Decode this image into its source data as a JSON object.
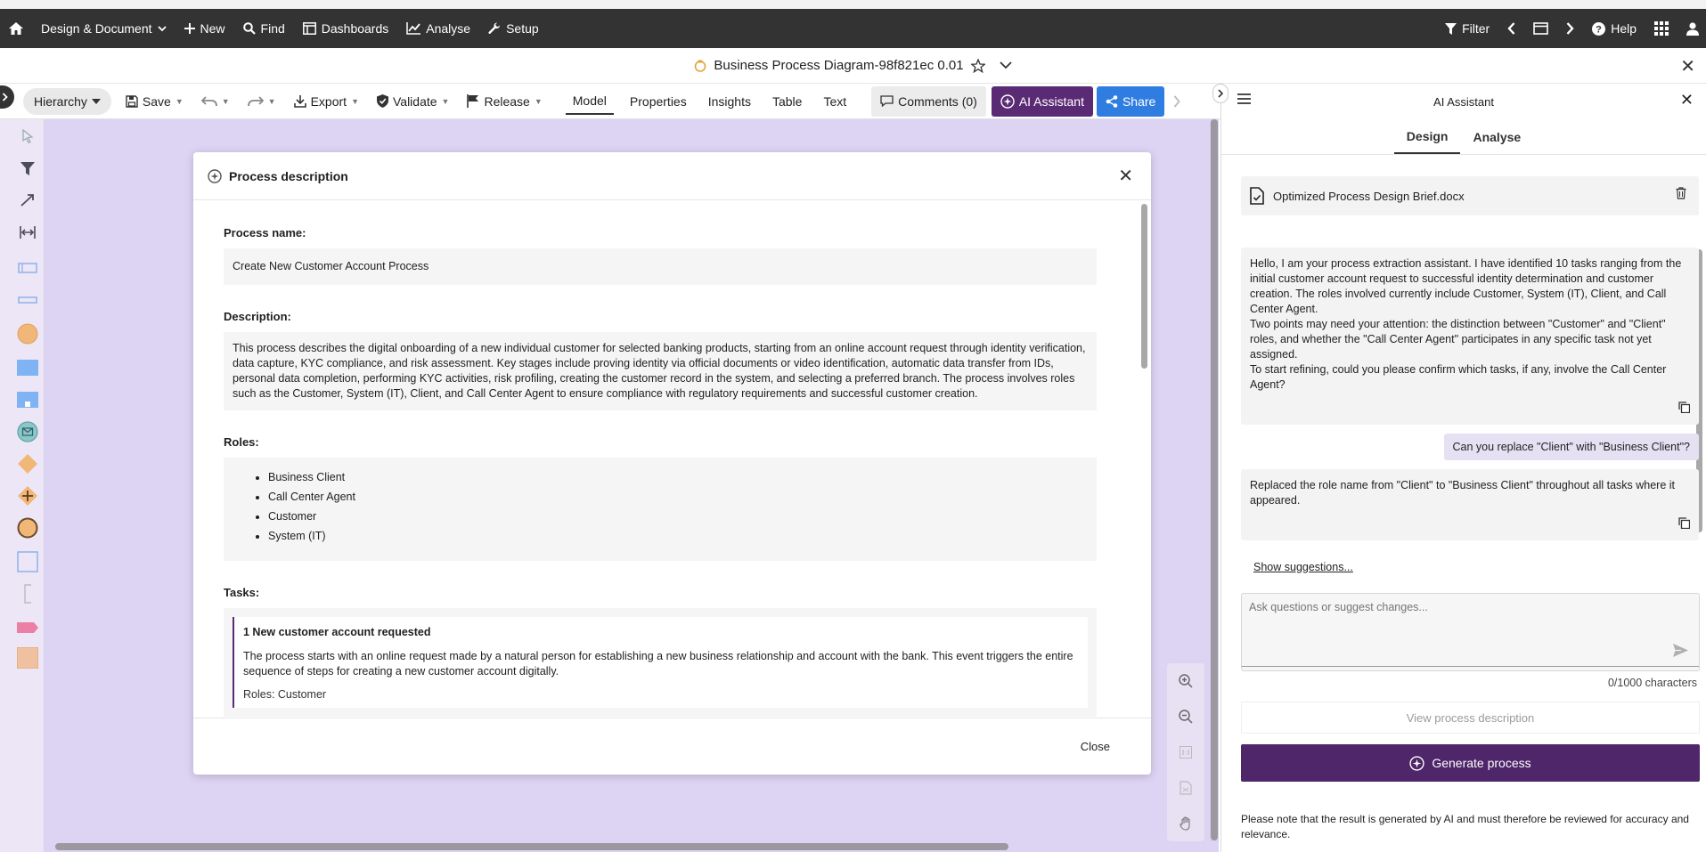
{
  "topnav": {
    "items": [
      {
        "label": "Design & Document",
        "icon": "chevron-down-icon"
      },
      {
        "label": "New",
        "icon": "plus-icon"
      },
      {
        "label": "Find",
        "icon": "search-icon"
      },
      {
        "label": "Dashboards",
        "icon": "dashboard-icon"
      },
      {
        "label": "Analyse",
        "icon": "chart-line-icon"
      },
      {
        "label": "Setup",
        "icon": "wrench-icon"
      }
    ],
    "right": {
      "filter": "Filter",
      "help": "Help"
    }
  },
  "titlebar": {
    "title": "Business Process Diagram-98f821ec 0.01"
  },
  "toolbar": {
    "hierarchy": "Hierarchy",
    "save": "Save",
    "export": "Export",
    "validate": "Validate",
    "release": "Release",
    "tabs": [
      "Model",
      "Properties",
      "Insights",
      "Table",
      "Text"
    ],
    "comments": "Comments (0)",
    "ai_assistant": "AI Assistant",
    "share": "Share"
  },
  "modal": {
    "title": "Process description",
    "process_name_label": "Process name:",
    "process_name": "Create New Customer Account Process",
    "description_label": "Description:",
    "description": "This process describes the digital onboarding of a new individual customer for selected banking products, starting from an online account request through identity verification, data capture, KYC compliance, and risk assessment. Key stages include proving identity via official documents or video identification, automatic data transfer from IDs, personal data completion, performing KYC activities, risk profiling, creating the customer record in the system, and selecting a preferred branch. The process involves roles such as the Customer, System (IT), Client, and Call Center Agent to ensure compliance with regulatory requirements and successful customer creation.",
    "roles_label": "Roles:",
    "roles": [
      "Business Client",
      "Call Center Agent",
      "Customer",
      "System (IT)"
    ],
    "tasks_label": "Tasks:",
    "tasks": [
      {
        "title": "1 New customer account requested",
        "description": "The process starts with an online request made by a natural person for establishing a new business relationship and account with the bank. This event triggers the entire sequence of steps for creating a new customer account digitally.",
        "roles": "Roles: Customer"
      }
    ],
    "close": "Close"
  },
  "ai_panel": {
    "title": "AI Assistant",
    "tabs": [
      "Design",
      "Analyse"
    ],
    "document": "Optimized Process Design Brief.docx",
    "messages": [
      {
        "from": "ai",
        "lines": [
          "Hello, I am your process extraction assistant. I have identified 10 tasks ranging from the initial customer account request to successful identity determination and customer creation. The roles involved currently include Customer, System (IT), Client, and Call Center Agent.",
          "Two points may need your attention: the distinction between \"Customer\" and \"Client\" roles, and whether the \"Call Center Agent\" participates in any specific task not yet assigned.",
          "To start refining, could you please confirm which tasks, if any, involve the Call Center Agent?"
        ]
      },
      {
        "from": "user",
        "text": "Can you replace \"Client\" with \"Business Client\"?"
      },
      {
        "from": "ai",
        "lines": [
          "Replaced the role name from \"Client\" to \"Business Client\" throughout all tasks where it appeared."
        ]
      }
    ],
    "show_suggestions": "Show suggestions...",
    "input_placeholder": "Ask questions or suggest changes...",
    "char_count": "0/1000 characters",
    "view_description": "View process description",
    "generate": "Generate process",
    "note": "Please note that the result is generated by AI and must therefore be reviewed for accuracy and relevance."
  },
  "colors": {
    "topnav_bg": "#333333",
    "accent_purple": "#5a2a74",
    "share_blue": "#2f7de0",
    "canvas_bg": "#ddd3f3"
  }
}
